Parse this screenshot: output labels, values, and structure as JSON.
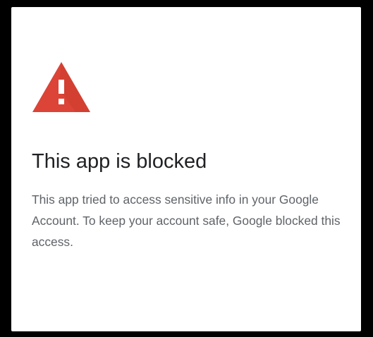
{
  "dialog": {
    "icon": "warning-triangle-icon",
    "title": "This app is blocked",
    "message": "This app tried to access sensitive info in your Google Account. To keep your account safe, Google blocked this access."
  },
  "colors": {
    "warning": "#db4437",
    "background": "#000000",
    "card": "#ffffff",
    "title_text": "#202124",
    "body_text": "#5f6368"
  }
}
